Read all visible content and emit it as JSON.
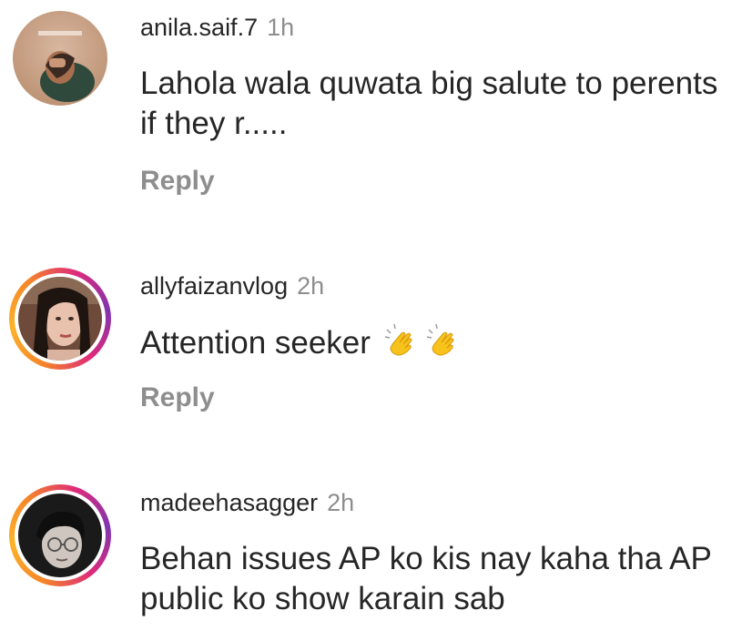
{
  "comments": [
    {
      "username": "anila.saif.7",
      "time": "1h",
      "text": "Lahola wala quwata big salute to perents if they r.....",
      "reply_label": "Reply",
      "has_story_ring": false
    },
    {
      "username": "allyfaizanvlog",
      "time": "2h",
      "text": "Attention seeker",
      "emojis": [
        "clapping-hands-icon",
        "clapping-hands-icon"
      ],
      "reply_label": "Reply",
      "has_story_ring": true
    },
    {
      "username": "madeehasagger",
      "time": "2h",
      "text": "Behan issues AP ko kis nay kaha tha AP public ko show karain sab",
      "has_story_ring": true
    }
  ],
  "colors": {
    "text": "#262626",
    "muted": "#8e8e8e",
    "story_ring_start": "#f58529",
    "story_ring_end": "#8134af"
  }
}
